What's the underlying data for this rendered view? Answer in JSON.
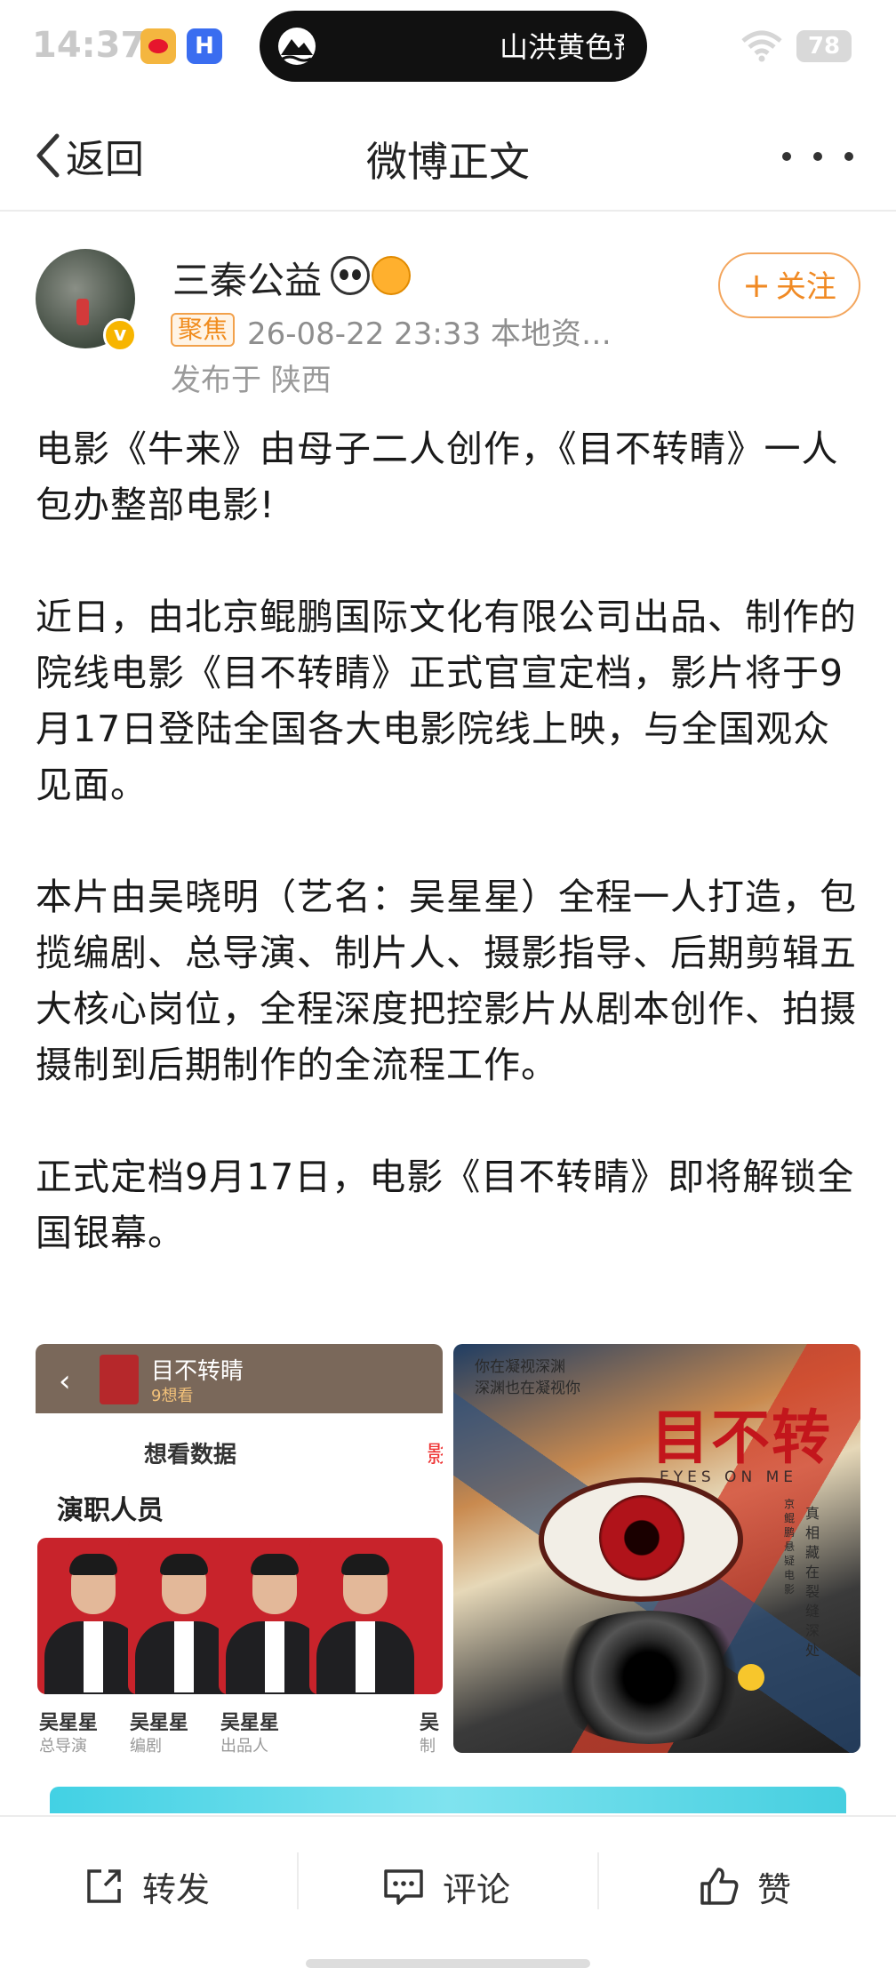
{
  "status_bar": {
    "time": "14:37",
    "island_text": "山洪黄色预",
    "battery": "78"
  },
  "nav": {
    "back_label": "返回",
    "title": "微博正文"
  },
  "author": {
    "name": "三秦公益",
    "tag": "聚焦",
    "meta": "26-08-22 23:33  本地资…",
    "location": "发布于 陕西",
    "follow_label": "关注"
  },
  "post": {
    "paragraphs": [
      "电影《牛来》由母子二人创作，《目不转睛》一人包办整部电影!",
      "近日，由北京鲲鹏国际文化有限公司出品、制作的院线电影《目不转睛》正式官宣定档，影片将于9月17日登陆全国各大电影院线上映，与全国观众见面。",
      "本片由吴晓明（艺名：吴星星）全程一人打造，包揽编剧、总导演、制片人、摄影指导、后期剪辑五大核心岗位，全程深度把控影片从剧本创作、拍摄摄制到后期制作的全流程工作。",
      "正式定档9月17日，电影《目不转睛》即将解锁全国银幕。"
    ]
  },
  "image_left": {
    "movie_title": "目不转睛",
    "want_count": "9想看",
    "tab": "想看数据",
    "tab_cut": "影",
    "cast_title": "演职人员",
    "cast": [
      {
        "name": "吴星星",
        "role": "总导演"
      },
      {
        "name": "吴星星",
        "role": "编剧"
      },
      {
        "name": "吴星星",
        "role": "出品人"
      },
      {
        "name": "吴",
        "role": "制"
      }
    ]
  },
  "image_right": {
    "top_lines": "你在凝视深渊\n深渊也在凝视你",
    "title": "目不转睛",
    "subtitle": "EYES ON ME",
    "tagline": "真相藏在裂缝深处",
    "tagline_small": "京鲲鹏悬疑电影"
  },
  "toolbar": {
    "repost_label": "转发",
    "comment_label": "评论",
    "like_label": "赞"
  }
}
